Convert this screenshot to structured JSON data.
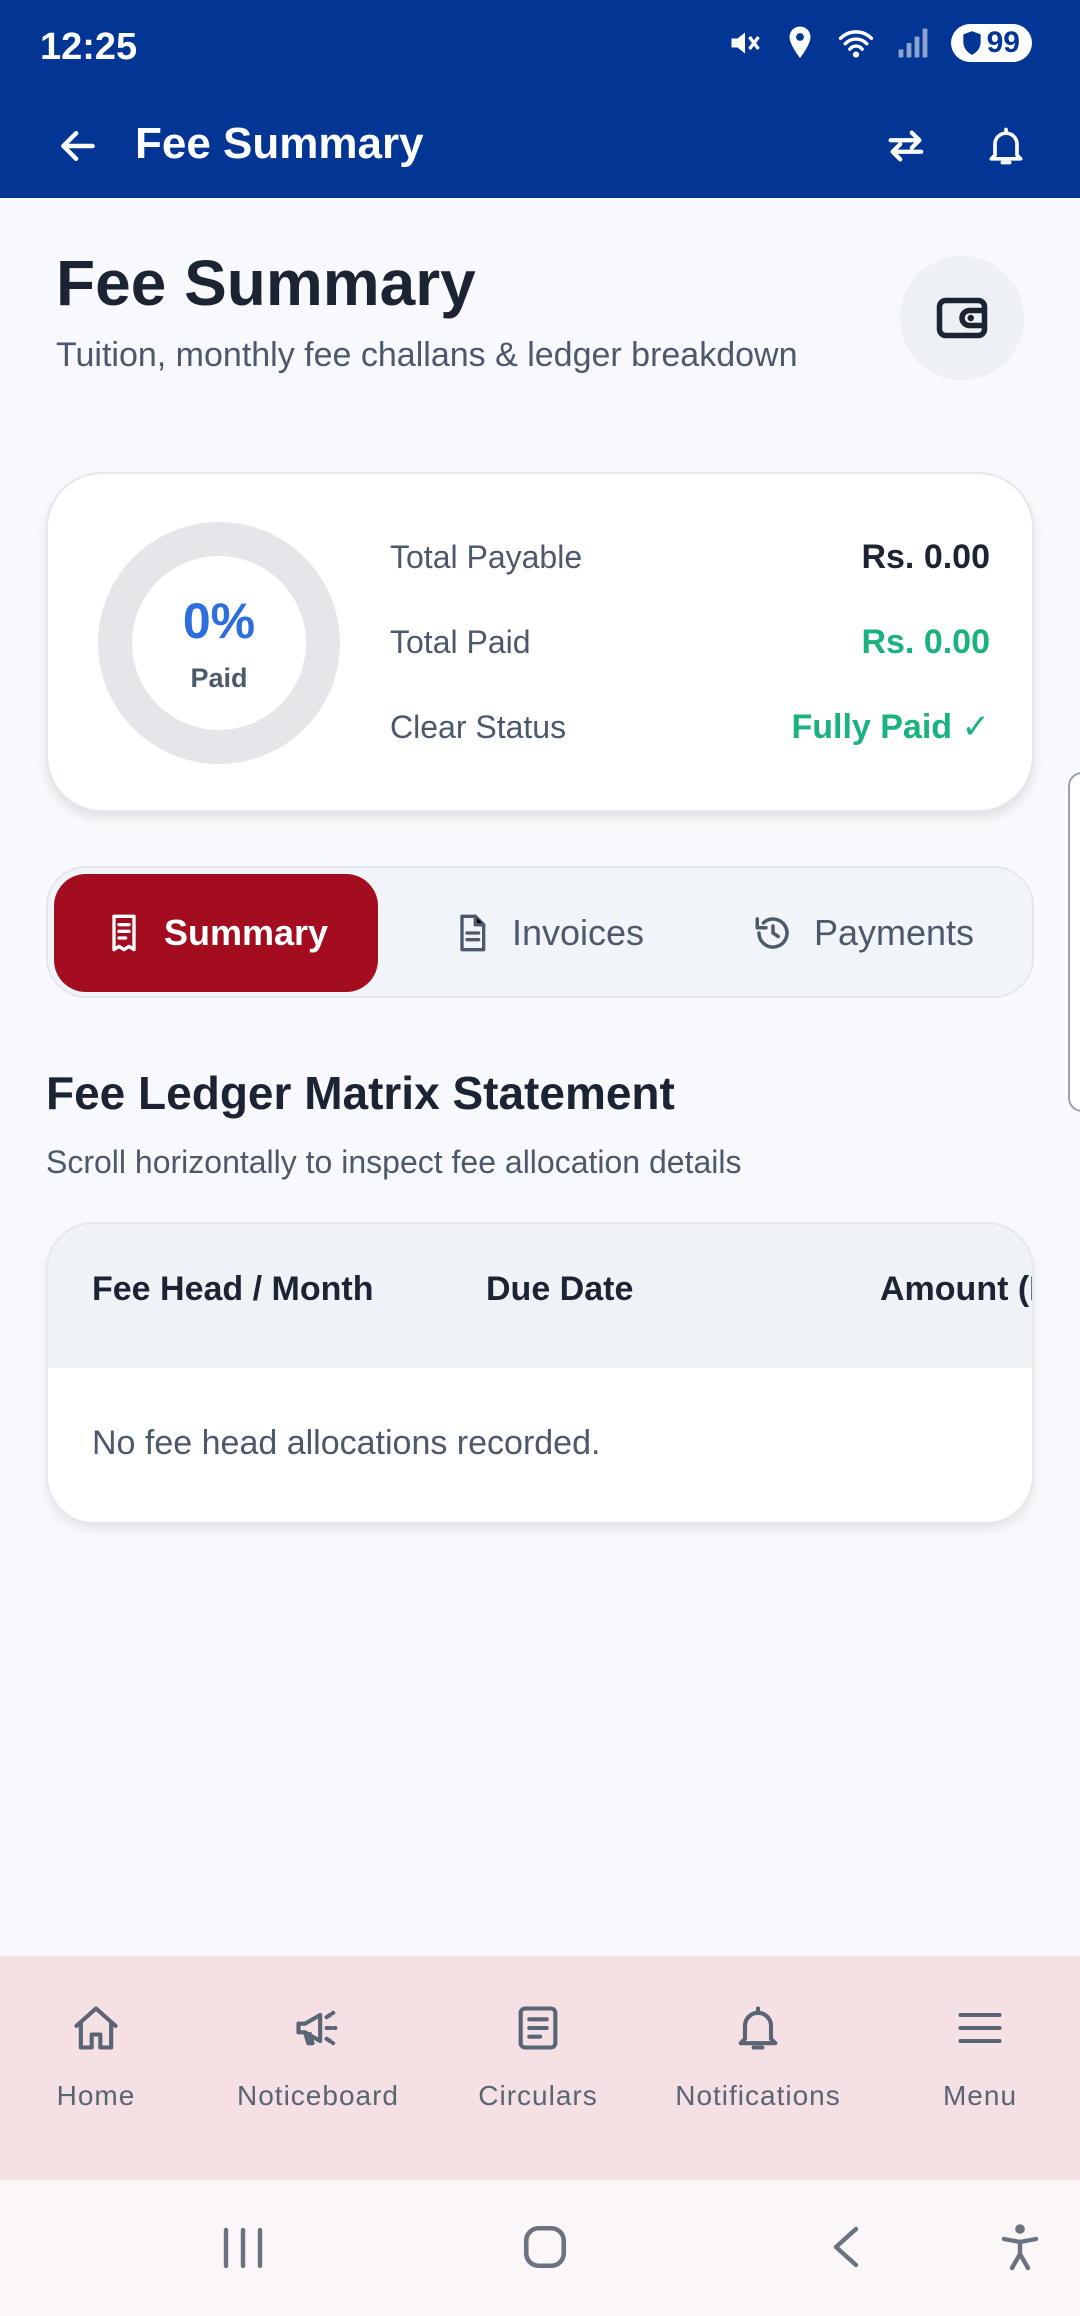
{
  "status": {
    "time": "12:25",
    "battery": "99"
  },
  "app_bar": {
    "title": "Fee Summary"
  },
  "header": {
    "title": "Fee Summary",
    "subtitle": "Tuition, monthly fee challans & ledger breakdown"
  },
  "summary": {
    "percent_label": "0%",
    "paid_label": "Paid",
    "paid_fraction": 0,
    "rows": [
      {
        "label": "Total Payable",
        "value": "Rs. 0.00"
      },
      {
        "label": "Total Paid",
        "value": "Rs. 0.00"
      },
      {
        "label": "Clear Status",
        "value": "Fully Paid ✓"
      }
    ]
  },
  "tabs": [
    {
      "label": "Summary",
      "icon": "receipt-icon",
      "active": true
    },
    {
      "label": "Invoices",
      "icon": "document-icon",
      "active": false
    },
    {
      "label": "Payments",
      "icon": "history-icon",
      "active": false
    }
  ],
  "ledger": {
    "title": "Fee Ledger Matrix Statement",
    "subtitle": "Scroll horizontally to inspect fee allocation details",
    "columns": [
      "Fee Head / Month",
      "Due Date",
      "Amount (R"
    ],
    "empty_text": "No fee head allocations recorded."
  },
  "bottom_nav": [
    {
      "label": "Home",
      "icon": "home-icon"
    },
    {
      "label": "Noticeboard",
      "icon": "megaphone-icon"
    },
    {
      "label": "Circulars",
      "icon": "circulars-icon"
    },
    {
      "label": "Notifications",
      "icon": "bell-icon"
    },
    {
      "label": "Menu",
      "icon": "menu-icon"
    }
  ],
  "colors": {
    "primary": "#023594",
    "accent_red": "#a30d1f",
    "success_green": "#1ab37d",
    "ring_blue": "#2f6fdd",
    "nav_bg": "#f5e1e3"
  }
}
